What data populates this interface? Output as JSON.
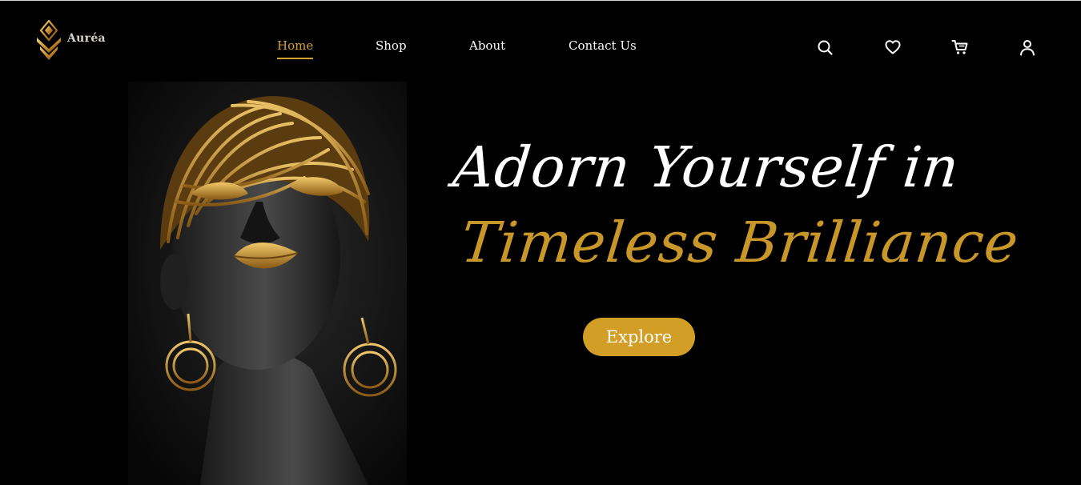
{
  "brand": {
    "name": "Auréa"
  },
  "nav": {
    "items": [
      {
        "label": "Home",
        "active": true
      },
      {
        "label": "Shop",
        "active": false
      },
      {
        "label": "About",
        "active": false
      },
      {
        "label": "Contact Us",
        "active": false
      }
    ]
  },
  "header_icons": [
    "search-icon",
    "heart-icon",
    "cart-icon",
    "user-icon"
  ],
  "hero": {
    "line1": "Adorn  Yourself in",
    "line2": "Timeless  Brilliance",
    "cta_label": "Explore"
  },
  "colors": {
    "background": "#000000",
    "accent_gold": "#d29e26",
    "text": "#ffffff"
  }
}
